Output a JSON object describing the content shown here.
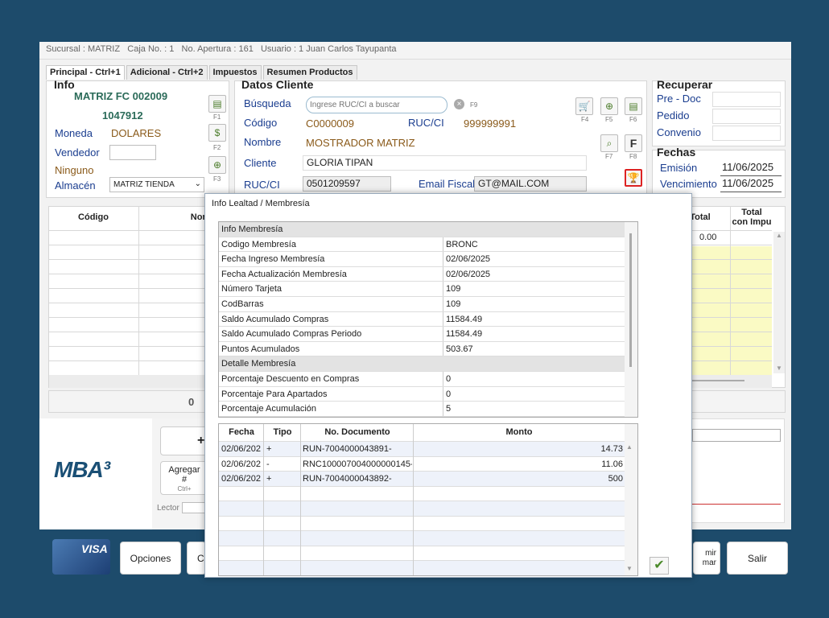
{
  "status": {
    "sucursal": "Sucursal : MATRIZ",
    "caja": "Caja No. : 1",
    "apertura": "No. Apertura : 161",
    "usuario": "Usuario : 1 Juan Carlos Tayupanta"
  },
  "tabs": [
    "Principal  - Ctrl+1",
    "Adicional  - Ctrl+2",
    "Impuestos",
    "Resumen Productos"
  ],
  "info": {
    "title": "Info",
    "doc": "MATRIZ FC 002009",
    "number": "1047912",
    "moneda_label": "Moneda",
    "moneda": "DOLARES",
    "vendedor_label": "Vendedor",
    "ninguno": "Ninguno",
    "almacen_label": "Almacén",
    "almacen": "MATRIZ TIENDA",
    "f1": "F1",
    "f2": "F2",
    "f3": "F3"
  },
  "cliente": {
    "title": "Datos Cliente",
    "busqueda_label": "Búsqueda",
    "busqueda_placeholder": "Ingrese RUC/CI a buscar",
    "f9": "F9",
    "codigo_label": "Código",
    "codigo": "C0000009",
    "rucci_label": "RUC/CI",
    "rucci_val": "999999991",
    "nombre_label": "Nombre",
    "nombre": "MOSTRADOR MATRIZ",
    "cliente_label": "Cliente",
    "cliente": "GLORIA TIPAN",
    "ruc2_label": "RUC/CI",
    "ruc2": "0501209597",
    "email_label": "Email Fiscal",
    "email": "GT@MAIL.COM",
    "f4": "F4",
    "f5": "F5",
    "f6": "F6",
    "f7": "F7",
    "f8": "F8"
  },
  "recuperar": {
    "title": "Recuperar",
    "predoc": "Pre - Doc",
    "pedido": "Pedido",
    "convenio": "Convenio"
  },
  "fechas": {
    "title": "Fechas",
    "emision_label": "Emisión",
    "emision": "11/06/2025",
    "vencimiento_label": "Vencimiento",
    "vencimiento": "11/06/2025"
  },
  "grid": {
    "codigo": "Código",
    "nombre": "Nom",
    "total": "Total",
    "total_impu_1": "Total",
    "total_impu_2": "con Impu",
    "total_val": "0.00",
    "zero": "0"
  },
  "left_bottom": {
    "agregar": "Agregar",
    "hash": "#",
    "ctrl": "Ctrl+",
    "plus": "+",
    "lector": "Lector"
  },
  "popup": {
    "title": "Info Lealtad / Membresía",
    "rows": [
      {
        "k": "Info Membresía",
        "v": "",
        "hdr": true
      },
      {
        "k": "Codigo Membresía",
        "v": "BRONC"
      },
      {
        "k": "Fecha Ingreso Membresía",
        "v": "02/06/2025"
      },
      {
        "k": "Fecha Actualización Membresía",
        "v": "02/06/2025"
      },
      {
        "k": "Número Tarjeta",
        "v": "109"
      },
      {
        "k": "CodBarras",
        "v": "109"
      },
      {
        "k": "Saldo Acumulado Compras",
        "v": "11584.49"
      },
      {
        "k": "Saldo Acumulado Compras Periodo",
        "v": "11584.49"
      },
      {
        "k": "Puntos Acumulados",
        "v": "503.67"
      },
      {
        "k": "Detalle Membresía",
        "v": "",
        "hdr": true
      },
      {
        "k": "Porcentaje Descuento en Compras",
        "v": "0"
      },
      {
        "k": "Porcentaje Para Apartados",
        "v": "0"
      },
      {
        "k": "Porcentaje Acumulación",
        "v": "5"
      }
    ],
    "tx_headers": [
      "Fecha",
      "Tipo",
      "No. Documento",
      "Monto"
    ],
    "tx": [
      {
        "fecha": "02/06/202",
        "tipo": "+",
        "doc": "RUN-7004000043891-",
        "monto": "14.73"
      },
      {
        "fecha": "02/06/202",
        "tipo": "-",
        "doc": "RNC100007004000000145-",
        "monto": "11.06"
      },
      {
        "fecha": "02/06/202",
        "tipo": "+",
        "doc": "RUN-7004000043892-",
        "monto": "500"
      }
    ]
  },
  "bottom": {
    "visa": "VISA",
    "opciones": "Opciones",
    "c": "C",
    "imprimir": "mir",
    "confirmar": "mar",
    "salir": "Salir"
  },
  "logo": "MBA³"
}
